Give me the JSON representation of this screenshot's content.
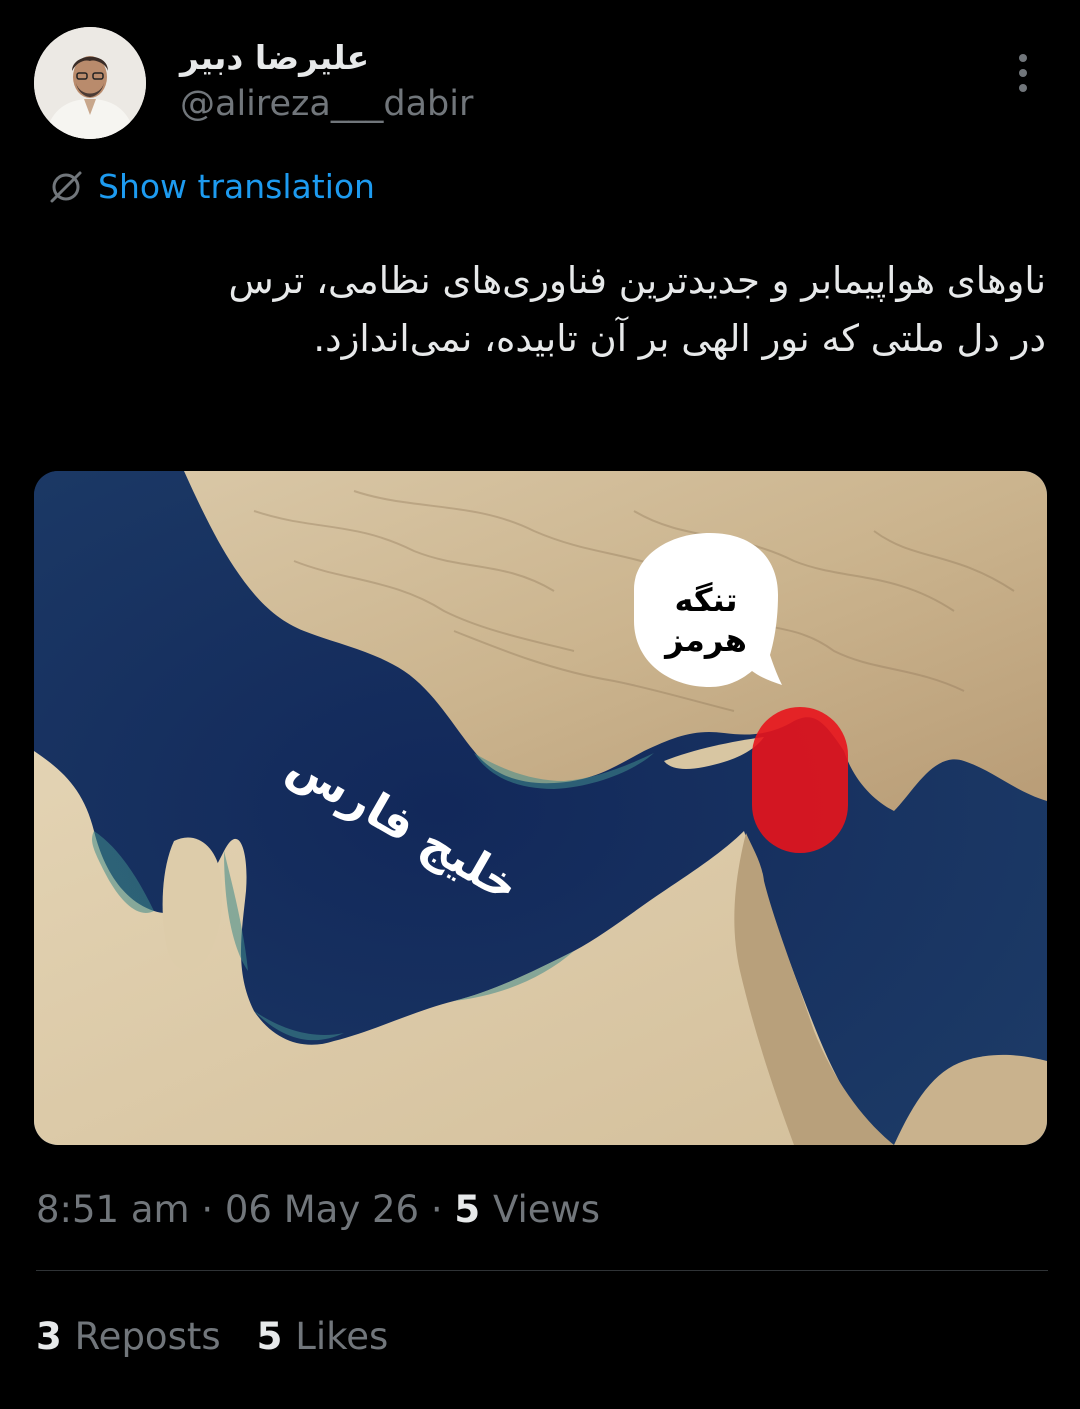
{
  "author": {
    "display_name": "علیرضا دبیر",
    "handle": "@alireza___dabir",
    "avatar_icon": "person-avatar"
  },
  "more_icon": "more-vertical-icon",
  "translation": {
    "label": "Show translation",
    "icon": "globe-slash-icon",
    "color": "#1d9bf0"
  },
  "tweet": {
    "line1": "ناوهای هواپیمابر و جدیدترین فناوری‌های نظامی، ترس",
    "line2": "در دل ملتی که نور الهی بر آن تابیده، نمی‌اندازد."
  },
  "media": {
    "strait_label_line1": "تنگه",
    "strait_label_line2": "هرمز",
    "gulf_label": "خلیج فارس",
    "highlight_color": "#e8141c"
  },
  "meta": {
    "time": "8:51 am",
    "date": "06 May 26",
    "views_count": "5",
    "views_label": "Views"
  },
  "stats": {
    "reposts_count": "3",
    "reposts_label": "Reposts",
    "likes_count": "5",
    "likes_label": "Likes"
  }
}
